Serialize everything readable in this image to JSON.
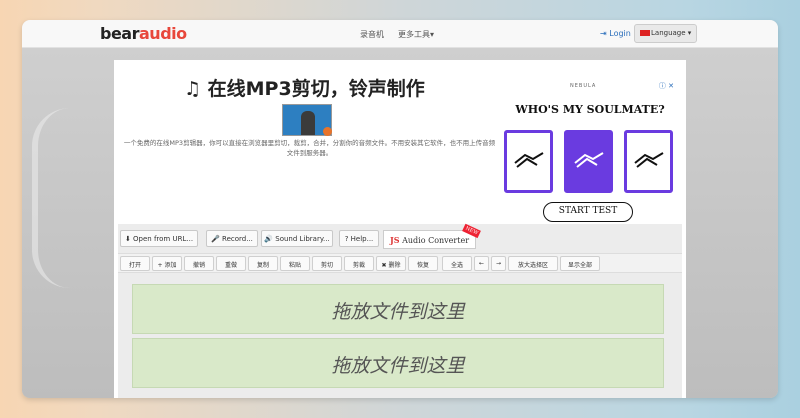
{
  "navbar": {
    "logo_part1": "bear",
    "logo_part2": "audio",
    "links": [
      "录音机",
      "更多工具▾"
    ],
    "login": "Login",
    "language": "Language ▾"
  },
  "main": {
    "title": "♫ 在线MP3剪切，铃声制作",
    "description": "一个免费的在线MP3剪辑器，你可以直接在浏览器里剪切，裁剪，合并，分割你的音频文件。不用安装其它软件，也不用上传音频文件到服务器。"
  },
  "ad": {
    "brand": "NEBULA",
    "close": "ⓘ ✕",
    "headline": "WHO'S MY SOULMATE?",
    "cta": "START TEST"
  },
  "toolbar": {
    "primary": [
      {
        "label": "⬇ Open from URL..."
      },
      {
        "label": "🎤 Record..."
      },
      {
        "label": "🔊 Sound Library..."
      },
      {
        "label": "? Help..."
      }
    ],
    "js_prefix": "JS",
    "js_rest": " Audio Converter",
    "new_tag": "NEW",
    "secondary": [
      "打开",
      "+ 添加",
      "撤销",
      "重做",
      "复制",
      "粘贴",
      "剪切",
      "剪裁",
      "✖ 删除",
      "恢复",
      "全选",
      "←",
      "→",
      "放大选择区",
      "显示全部"
    ]
  },
  "dropzones": [
    "拖放文件到这里",
    "拖放文件到这里"
  ]
}
